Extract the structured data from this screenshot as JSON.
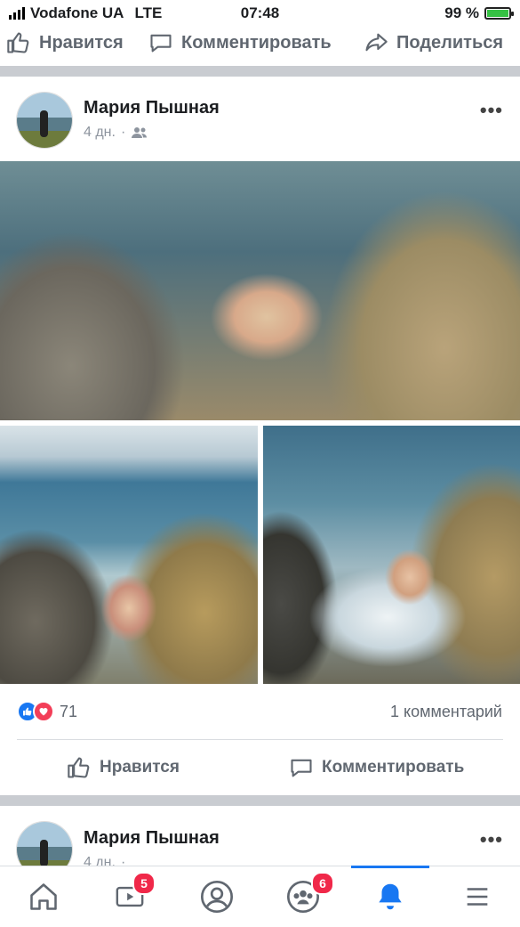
{
  "status_bar": {
    "carrier": "Vodafone UA",
    "network": "LTE",
    "time": "07:48",
    "battery": "99 %",
    "battery_level": 0.99
  },
  "top_actions": {
    "like": "Нравится",
    "comment": "Комментировать",
    "share": "Поделиться"
  },
  "post": {
    "author": "Мария Пышная",
    "time": "4 дн.",
    "separator": "·",
    "more": "•••",
    "reaction_count": "71",
    "comments": "1 комментарий",
    "actions": {
      "like": "Нравится",
      "comment": "Комментировать"
    }
  },
  "next_post": {
    "author": "Мария Пышная",
    "time": "4 дн.",
    "separator": "·",
    "more": "•••"
  },
  "bottom_nav": {
    "video_badge": "5",
    "groups_badge": "6"
  },
  "colors": {
    "accent": "#1877f2",
    "badge": "#f02849",
    "love": "#f33e58",
    "battery": "#36c144"
  }
}
